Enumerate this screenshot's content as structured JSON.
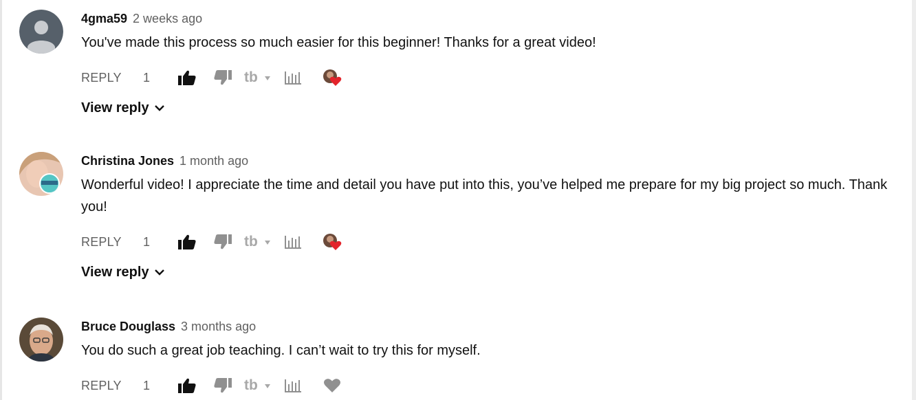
{
  "comments": [
    {
      "author": "4gma59",
      "time": "2 weeks ago",
      "text": "You've made this process so much easier for this beginner! Thanks for a great video!",
      "reply_label": "REPLY",
      "likes": "1",
      "hearted": true,
      "view_reply_label": "View reply",
      "avatar": "default-user-avatar"
    },
    {
      "author": "Christina Jones",
      "time": "1 month ago",
      "text": "Wonderful video!  I appreciate the time and detail you have put into this, you’ve helped me prepare for my big project so much. Thank you!",
      "reply_label": "REPLY",
      "likes": "1",
      "hearted": true,
      "view_reply_label": "View reply",
      "avatar": "photo-avatar"
    },
    {
      "author": "Bruce Douglass",
      "time": "3 months ago",
      "text": "You do such a great job teaching.  I can’t wait to try this for myself.",
      "reply_label": "REPLY",
      "likes": "1",
      "hearted": false,
      "avatar": "photo-avatar"
    }
  ],
  "icons": {
    "like": "thumbs-up-icon",
    "dislike": "thumbs-down-icon",
    "tb": "tubebuddy-icon",
    "stats": "bar-chart-icon",
    "heart": "heart-icon"
  },
  "colors": {
    "heart_red": "#e3242b",
    "muted_text": "#606060",
    "icon_grey": "#909090"
  }
}
